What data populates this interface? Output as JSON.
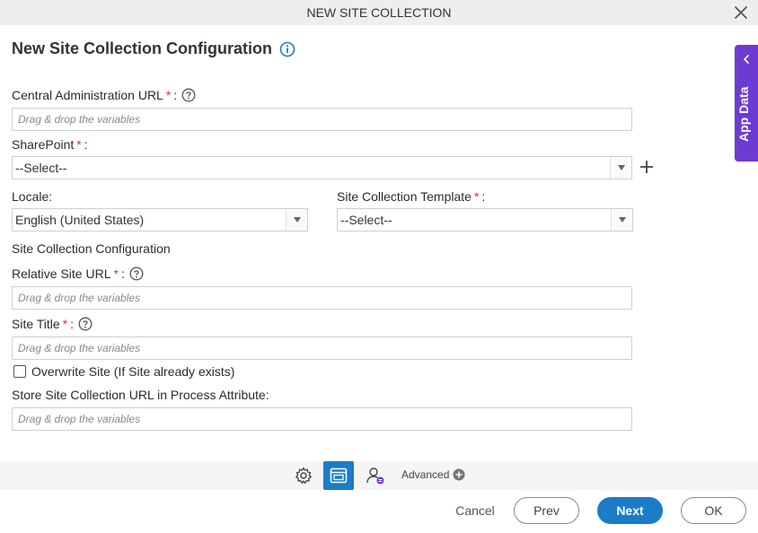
{
  "window": {
    "title": "NEW SITE COLLECTION"
  },
  "page": {
    "title": "New Site Collection Configuration"
  },
  "fields": {
    "central_admin_url": {
      "label": "Central Administration URL",
      "placeholder": "Drag & drop the variables"
    },
    "sharepoint": {
      "label": "SharePoint",
      "value": "--Select--"
    },
    "locale": {
      "label": "Locale:",
      "value": "English (United States)"
    },
    "site_collection_template": {
      "label": "Site Collection Template",
      "value": "--Select--"
    },
    "relative_site_url": {
      "label": "Relative Site URL",
      "placeholder": "Drag & drop the variables"
    },
    "site_title": {
      "label": "Site Title",
      "placeholder": "Drag & drop the variables"
    },
    "overwrite_site": {
      "label": "Overwrite Site (If Site already exists)",
      "checked": false
    },
    "store_url": {
      "label": "Store Site Collection URL in Process Attribute:",
      "placeholder": "Drag & drop the variables"
    }
  },
  "required_marker": "*",
  "colon": ":",
  "section": {
    "site_collection_config": "Site Collection Configuration"
  },
  "app_data": {
    "label": "App Data"
  },
  "toolbar": {
    "advanced_label": "Advanced"
  },
  "footer": {
    "cancel": "Cancel",
    "prev": "Prev",
    "next": "Next",
    "ok": "OK"
  },
  "colors": {
    "accent": "#1b7cc7",
    "app_data_bg": "#6c3bd2",
    "required": "#d9342b"
  }
}
